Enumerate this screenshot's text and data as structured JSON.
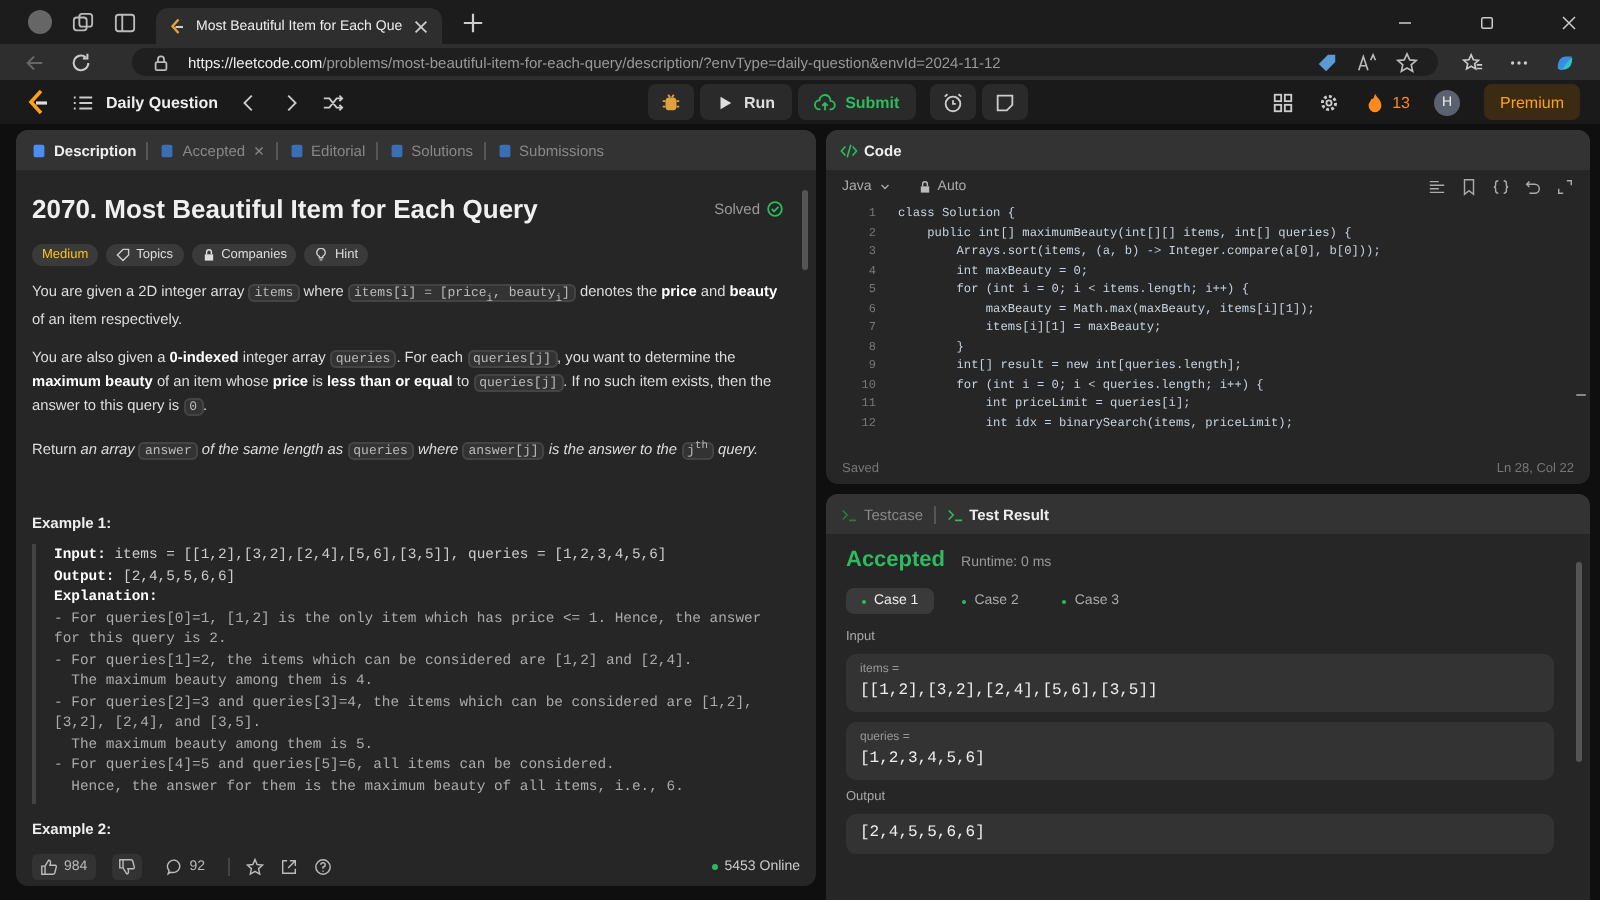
{
  "browser": {
    "tabs": [
      {
        "title": "Most Beautiful Item for Each Que",
        "selected": true
      }
    ],
    "url": {
      "host": "https://leetcode.com",
      "path": "/problems/most-beautiful-item-for-each-query/description/?envType=daily-question&envId=2024-11-12"
    }
  },
  "header": {
    "title": "Daily Question",
    "run": "Run",
    "submit": "Submit",
    "streak": "13",
    "avatar": "H",
    "premium": "Premium"
  },
  "description": {
    "tabs": [
      {
        "label": "Description",
        "selected": true,
        "closable": false
      },
      {
        "label": "Accepted",
        "selected": false,
        "closable": true
      },
      {
        "label": "Editorial",
        "selected": false,
        "closable": false
      },
      {
        "label": "Solutions",
        "selected": false,
        "closable": false
      },
      {
        "label": "Submissions",
        "selected": false,
        "closable": false
      }
    ],
    "title": "2070. Most Beautiful Item for Each Query",
    "status": "Solved",
    "tags": [
      {
        "kind": "difficulty",
        "label": "Medium"
      },
      {
        "kind": "topics",
        "label": "Topics"
      },
      {
        "kind": "companies",
        "label": "Companies"
      },
      {
        "kind": "hint",
        "label": "Hint"
      }
    ],
    "paragraphs": [
      [
        {
          "kind": "text",
          "text": "You are given a 2D integer array "
        },
        {
          "kind": "code",
          "text": "items"
        },
        {
          "kind": "text",
          "text": " where "
        },
        {
          "kind": "code",
          "text": "items[i] = [price$_{i}$, beauty$_{i}$]"
        },
        {
          "kind": "text",
          "text": " denotes the **price** and **beauty** of an item respectively."
        }
      ],
      [
        {
          "kind": "text",
          "text": "You are also given a **0-indexed** integer array "
        },
        {
          "kind": "code",
          "text": "queries"
        },
        {
          "kind": "text",
          "text": ". For each "
        },
        {
          "kind": "code",
          "text": "queries[j]"
        },
        {
          "kind": "text",
          "text": ", you want to determine the **maximum beauty** of an item whose **price** is **less than or equal** to "
        },
        {
          "kind": "code",
          "text": "queries[j]"
        },
        {
          "kind": "text",
          "text": ". If no such item exists, then the answer to this query is "
        },
        {
          "kind": "code",
          "text": "0"
        },
        {
          "kind": "text",
          "text": "."
        }
      ],
      [
        {
          "kind": "text",
          "text": "Return *an array* "
        },
        {
          "kind": "code",
          "text": "answer"
        },
        {
          "kind": "text",
          "text": " *of the same length as* "
        },
        {
          "kind": "code",
          "text": "queries"
        },
        {
          "kind": "text",
          "text": " *where* "
        },
        {
          "kind": "code",
          "text": "answer[j]"
        },
        {
          "kind": "text",
          "text": " *is the answer to the* "
        },
        {
          "kind": "code",
          "text": "j$^{th}$"
        },
        {
          "kind": "text",
          "text": " *query.*"
        }
      ]
    ],
    "examples": [
      {
        "title": "Example 1:",
        "lines": [
          {
            "kind": "field",
            "label": "Input:",
            "value": "items = [[1,2],[3,2],[2,4],[5,6],[3,5]], queries = [1,2,3,4,5,6]"
          },
          {
            "kind": "field",
            "label": "Output:",
            "value": "[2,4,5,5,6,6]"
          },
          {
            "kind": "heading",
            "text": "Explanation:"
          },
          {
            "kind": "text",
            "text": "- For queries[0]=1, [1,2] is the only item which has price <= 1. Hence, the answer for this query is 2."
          },
          {
            "kind": "text",
            "text": "- For queries[1]=2, the items which can be considered are [1,2] and [2,4]."
          },
          {
            "kind": "text",
            "text": "  The maximum beauty among them is 4."
          },
          {
            "kind": "text",
            "text": "- For queries[2]=3 and queries[3]=4, the items which can be considered are [1,2], [3,2], [2,4], and [3,5]."
          },
          {
            "kind": "text",
            "text": "  The maximum beauty among them is 5."
          },
          {
            "kind": "text",
            "text": "- For queries[4]=5 and queries[5]=6, all items can be considered."
          },
          {
            "kind": "text",
            "text": "  Hence, the answer for them is the maximum beauty of all items, i.e., 6."
          }
        ]
      },
      {
        "title": "Example 2:"
      }
    ],
    "footer": {
      "likes": "984",
      "comments": "92",
      "online": "5453 Online"
    }
  },
  "code": {
    "title": "Code",
    "language": "Java",
    "mode": "Auto",
    "lines": [
      {
        "number": "1",
        "text": "class Solution {"
      },
      {
        "number": "2",
        "text": "    public int[] maximumBeauty(int[][] items, int[] queries) {"
      },
      {
        "number": "3",
        "text": "        Arrays.sort(items, (a, b) -> Integer.compare(a[0], b[0]));"
      },
      {
        "number": "4",
        "text": "        int maxBeauty = 0;"
      },
      {
        "number": "5",
        "text": "        for (int i = 0; i < items.length; i++) {"
      },
      {
        "number": "6",
        "text": "            maxBeauty = Math.max(maxBeauty, items[i][1]);"
      },
      {
        "number": "7",
        "text": "            items[i][1] = maxBeauty;"
      },
      {
        "number": "8",
        "text": "        }"
      },
      {
        "number": "9",
        "text": "        int[] result = new int[queries.length];"
      },
      {
        "number": "10",
        "text": "        for (int i = 0; i < queries.length; i++) {"
      },
      {
        "number": "11",
        "text": "            int priceLimit = queries[i];"
      },
      {
        "number": "12",
        "text": "            int idx = binarySearch(items, priceLimit);"
      }
    ],
    "status": "Saved",
    "cursor": "Ln 28, Col 22"
  },
  "result": {
    "tabs": [
      {
        "label": "Testcase",
        "selected": false
      },
      {
        "label": "Test Result",
        "selected": true
      }
    ],
    "verdict": "Accepted",
    "runtime": "Runtime: 0 ms",
    "cases": [
      {
        "label": "Case 1",
        "selected": true
      },
      {
        "label": "Case 2",
        "selected": false
      },
      {
        "label": "Case 3",
        "selected": false
      }
    ],
    "input_label": "Input",
    "params": [
      {
        "name": "items =",
        "value": "[[1,2],[3,2],[2,4],[5,6],[3,5]]"
      },
      {
        "name": "queries =",
        "value": "[1,2,3,4,5,6]"
      }
    ],
    "output_label": "Output",
    "output": "[2,4,5,5,6,6]"
  }
}
